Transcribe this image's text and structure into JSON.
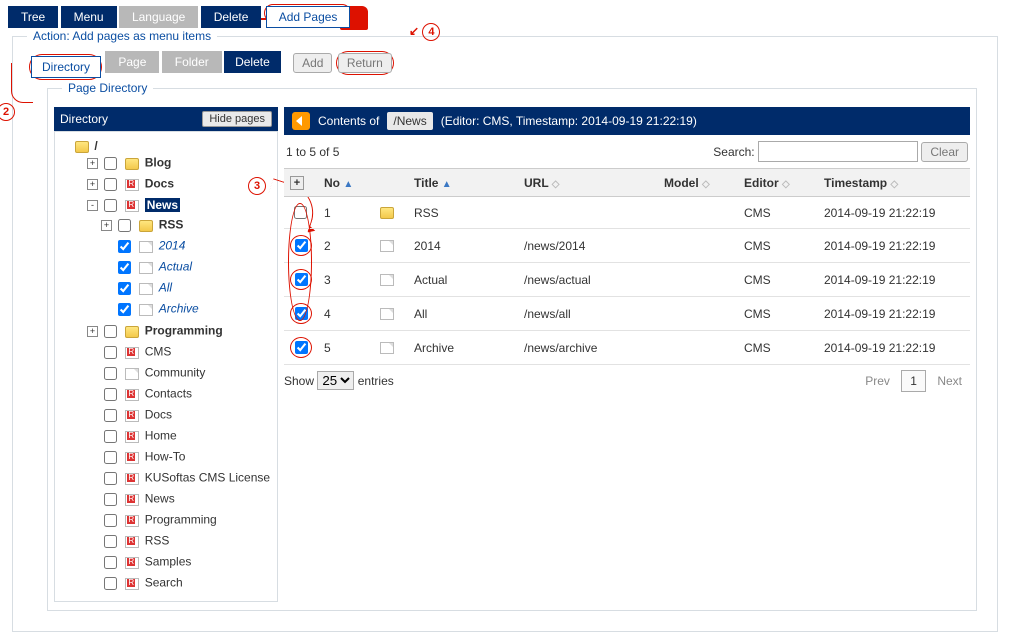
{
  "annotations": {
    "n2": "2",
    "n3": "3",
    "n4": "4"
  },
  "topTabs": {
    "tree": "Tree",
    "menu": "Menu",
    "language": "Language",
    "delete": "Delete",
    "addPages": "Add Pages"
  },
  "action": {
    "legend": "Action: Add pages as menu items",
    "tabs": {
      "directory": "Directory",
      "page": "Page",
      "folder": "Folder",
      "delete": "Delete"
    },
    "buttons": {
      "add": "Add",
      "return": "Return"
    }
  },
  "pageDirectory": {
    "legend": "Page Directory",
    "leftHeader": "Directory",
    "hidePages": "Hide pages",
    "root": "/",
    "tree": {
      "blog": "Blog",
      "docs": "Docs",
      "news": "News",
      "rss": "RSS",
      "y2014": "2014",
      "actual": "Actual",
      "all": "All",
      "archive": "Archive",
      "programming": "Programming",
      "cms": "CMS",
      "community": "Community",
      "contacts": "Contacts",
      "docs2": "Docs",
      "home": "Home",
      "howto": "How-To",
      "license": "KUSoftas CMS License",
      "news2": "News",
      "programming2": "Programming",
      "rss2": "RSS",
      "samples": "Samples",
      "search": "Search"
    }
  },
  "contents": {
    "back": "back",
    "label": "Contents of",
    "path": "/News",
    "meta": "(Editor: CMS, Timestamp: 2014-09-19 21:22:19)",
    "range": "1 to 5 of 5",
    "searchLabel": "Search:",
    "clear": "Clear",
    "headers": {
      "no": "No",
      "title": "Title",
      "url": "URL",
      "model": "Model",
      "editor": "Editor",
      "timestamp": "Timestamp"
    },
    "rows": [
      {
        "checked": false,
        "no": "1",
        "icon": "folder",
        "title": "RSS",
        "url": "",
        "model": "",
        "editor": "CMS",
        "timestamp": "2014-09-19 21:22:19"
      },
      {
        "checked": true,
        "no": "2",
        "icon": "page",
        "title": "2014",
        "url": "/news/2014",
        "model": "",
        "editor": "CMS",
        "timestamp": "2014-09-19 21:22:19"
      },
      {
        "checked": true,
        "no": "3",
        "icon": "page",
        "title": "Actual",
        "url": "/news/actual",
        "model": "",
        "editor": "CMS",
        "timestamp": "2014-09-19 21:22:19"
      },
      {
        "checked": true,
        "no": "4",
        "icon": "page",
        "title": "All",
        "url": "/news/all",
        "model": "",
        "editor": "CMS",
        "timestamp": "2014-09-19 21:22:19"
      },
      {
        "checked": true,
        "no": "5",
        "icon": "page",
        "title": "Archive",
        "url": "/news/archive",
        "model": "",
        "editor": "CMS",
        "timestamp": "2014-09-19 21:22:19"
      }
    ],
    "show": "Show",
    "entries": "entries",
    "pagesize": "25",
    "prev": "Prev",
    "next": "Next",
    "page": "1"
  }
}
